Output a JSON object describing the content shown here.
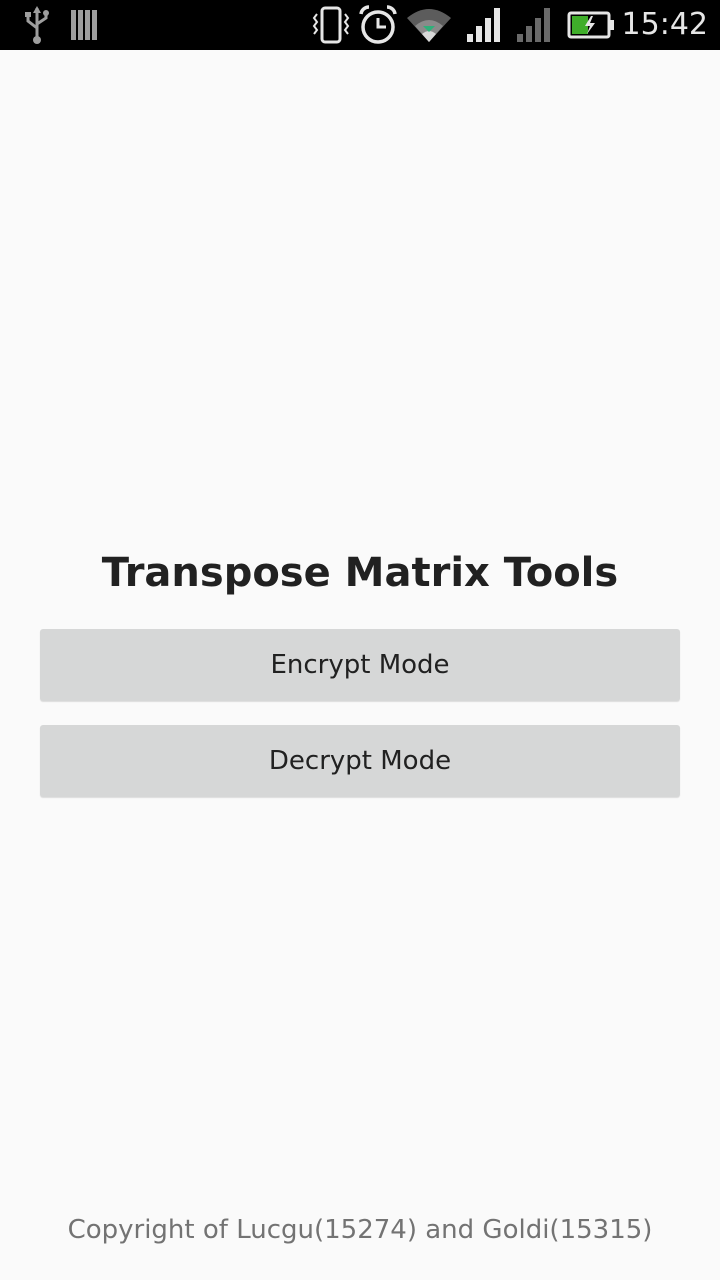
{
  "status_bar": {
    "time": "15:42",
    "icons": [
      "usb-icon",
      "storage-icon",
      "vibrate-icon",
      "alarm-clock-icon",
      "wifi-icon",
      "signal-icon",
      "signal-weak-icon",
      "battery-charging-icon"
    ],
    "battery_color": "#3fae2a",
    "background": "#000000"
  },
  "main": {
    "title": "Transpose Matrix Tools",
    "buttons": {
      "encrypt_label": "Encrypt Mode",
      "decrypt_label": "Decrypt Mode"
    },
    "button_color": "#d6d7d7",
    "background": "#fafafa"
  },
  "footer": {
    "copyright": "Copyright of Lucgu(15274) and Goldi(15315)"
  }
}
